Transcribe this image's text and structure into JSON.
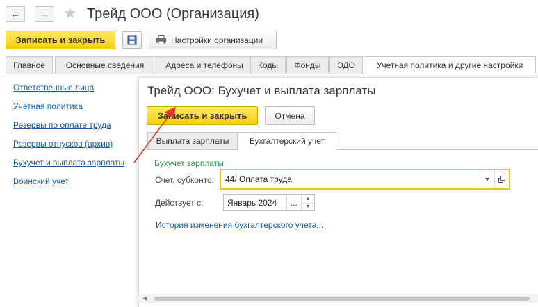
{
  "window": {
    "title": "Трейд ООО (Организация)",
    "back_glyph": "←",
    "forward_glyph": "→",
    "star_glyph": "★"
  },
  "toolbar": {
    "save_close_label": "Записать и закрыть",
    "org_settings_label": "Настройки организации"
  },
  "tabs": [
    {
      "label": "Главное"
    },
    {
      "label": "Основные сведения"
    },
    {
      "label": "Адреса и телефоны"
    },
    {
      "label": "Коды"
    },
    {
      "label": "Фонды"
    },
    {
      "label": "ЭДО"
    },
    {
      "label": "Учетная политика и другие настройки"
    }
  ],
  "sidebar": {
    "links": [
      {
        "label": "Ответственные лица"
      },
      {
        "label": "Учетная политика"
      },
      {
        "label": "Резервы по оплате труда"
      },
      {
        "label": "Резервы отпусков (архив)"
      },
      {
        "label": "Бухучет и выплата зарплаты"
      },
      {
        "label": "Воинский учет"
      }
    ]
  },
  "dialog": {
    "title": "Трейд ООО: Бухучет и выплата зарплаты",
    "save_close_label": "Записать и закрыть",
    "cancel_label": "Отмена",
    "tabs": [
      {
        "label": "Выплата зарплаты"
      },
      {
        "label": "Бухгалтерский учет"
      }
    ],
    "section_title": "Бухучет зарплаты",
    "account_label": "Счет, субконто:",
    "account_value": "44/ Оплата труда",
    "effective_label": "Действует с:",
    "effective_value": "Январь 2024",
    "dots_glyph": "...",
    "history_link": "История изменения бухгалтерского учета..."
  },
  "colors": {
    "accent_yellow": "#f6cf12",
    "link_blue": "#1a5aa0",
    "section_green": "#2e9a4b",
    "arrow_red": "#e0392b"
  }
}
